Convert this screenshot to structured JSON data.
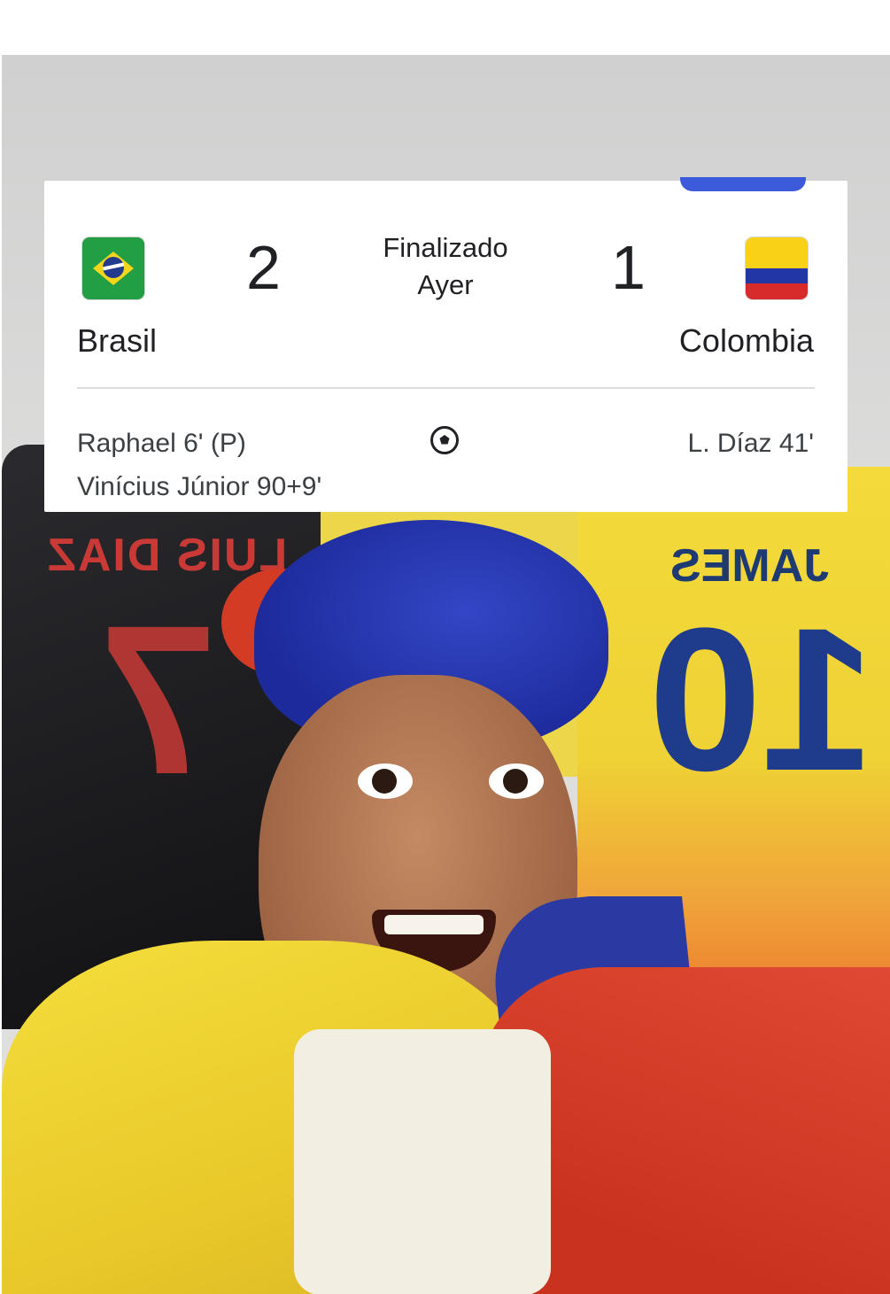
{
  "match": {
    "status": "Finalizado",
    "date": "Ayer",
    "home": {
      "team": "Brasil",
      "score": "2",
      "flag_icon": "brazil-flag-icon",
      "scorers": [
        "Raphael 6' (P)",
        "Vinícius Júnior 90+9'"
      ]
    },
    "away": {
      "team": "Colombia",
      "score": "1",
      "flag_icon": "colombia-flag-icon",
      "scorers": [
        "L. Díaz 41'"
      ]
    },
    "goals_icon": "soccer-ball-icon"
  },
  "colors": {
    "card_background": "#ffffff",
    "tab_indicator": "#3b5bdb",
    "divider": "#dadce0",
    "text_primary": "#202124"
  }
}
